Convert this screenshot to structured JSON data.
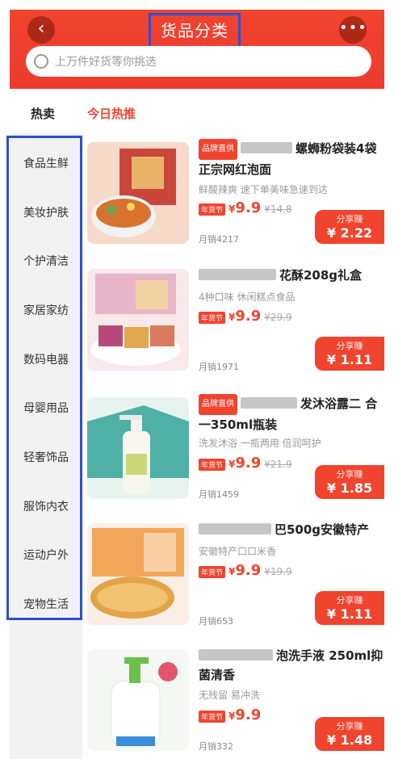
{
  "header": {
    "title": "货品分类",
    "back_icon": "‹",
    "more_icon": "•••",
    "search_placeholder": "上万件好货等你挑选"
  },
  "tabs": [
    {
      "label": "热卖"
    },
    {
      "label": "今日热推"
    }
  ],
  "sidebar": {
    "items": [
      {
        "label": "食品生鲜"
      },
      {
        "label": "美妆护肤"
      },
      {
        "label": "个护清洁"
      },
      {
        "label": "家居家纺"
      },
      {
        "label": "数码电器"
      },
      {
        "label": "母婴用品"
      },
      {
        "label": "轻奢饰品"
      },
      {
        "label": "服饰内衣"
      },
      {
        "label": "运动户外"
      },
      {
        "label": "宠物生活"
      }
    ]
  },
  "products": [
    {
      "brand_badge": "品牌直供",
      "title_visible": "螺蛳粉袋装4袋 正宗网红泡面",
      "subtitle": "鲜酸辣爽 速下单美味急速到达",
      "fest_badge": "年货节",
      "price_now": "9.9",
      "price_old": "¥14.8",
      "sales": "月销4217",
      "share_label": "分享赚",
      "share_amount": "¥ 2.22"
    },
    {
      "brand_badge": "",
      "title_visible": "花酥208g礼盒",
      "subtitle": "4种口味 休闲糕点食品",
      "fest_badge": "年货节",
      "price_now": "9.9",
      "price_old": "¥29.9",
      "sales": "月销1971",
      "share_label": "分享赚",
      "share_amount": "¥ 1.11"
    },
    {
      "brand_badge": "品牌直供",
      "title_visible": "发沐浴露二 合一350ml瓶装",
      "subtitle": "洗发沐浴 一瓶两用 倍润呵护",
      "fest_badge": "年货节",
      "price_now": "9.9",
      "price_old": "¥21.9",
      "sales": "月销1459",
      "share_label": "分享赚",
      "share_amount": "¥ 1.85"
    },
    {
      "brand_badge": "",
      "title_visible": "巴500g安徽特产",
      "subtitle": "安徽特产口口米香",
      "fest_badge": "年货节",
      "price_now": "9.9",
      "price_old": "¥19.9",
      "sales": "月销653",
      "share_label": "分享赚",
      "share_amount": "¥ 1.11"
    },
    {
      "brand_badge": "",
      "title_visible": "泡洗手液 250ml抑菌清香",
      "subtitle": "无残留 易冲洗",
      "fest_badge": "年货节",
      "price_now": "9.9",
      "price_old": "",
      "sales": "月销332",
      "share_label": "分享赚",
      "share_amount": "¥ 1.48"
    }
  ],
  "colors": {
    "accent": "#f0442f",
    "annotation_box": "#2c4fd1"
  }
}
